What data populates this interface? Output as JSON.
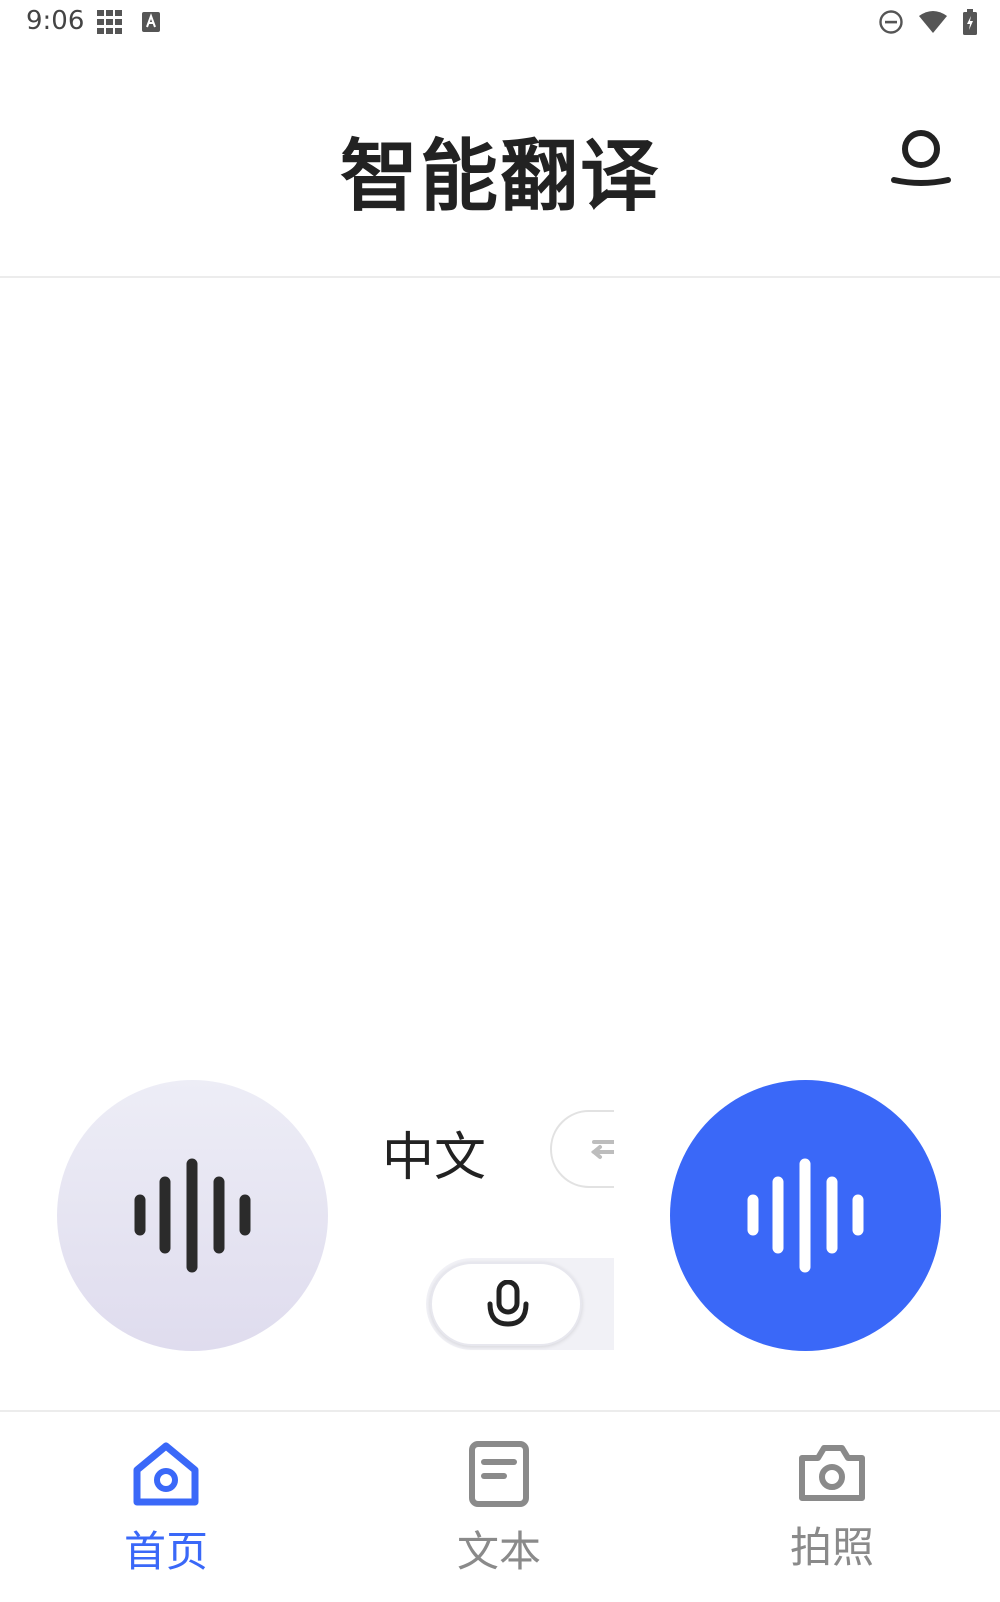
{
  "status_bar": {
    "time": "9:06",
    "icons": [
      "grid-icon",
      "a-icon",
      "dnd-icon",
      "wifi-icon",
      "battery-icon"
    ]
  },
  "header": {
    "title": "智能翻译",
    "profile_icon": "user-icon"
  },
  "translation": {
    "source_language": "中文",
    "swap_icon": "swap-icon",
    "mic_icon": "mic-icon",
    "left_button_icon": "sound-wave-icon",
    "right_button_icon": "sound-wave-icon"
  },
  "colors": {
    "accent": "#3a68f8",
    "inactive": "#8a8a8a",
    "left_button": "#e6e4f2"
  },
  "bottom_nav": {
    "items": [
      {
        "label": "首页",
        "icon": "home-icon",
        "active": true
      },
      {
        "label": "文本",
        "icon": "document-icon",
        "active": false
      },
      {
        "label": "拍照",
        "icon": "camera-icon",
        "active": false
      }
    ]
  }
}
